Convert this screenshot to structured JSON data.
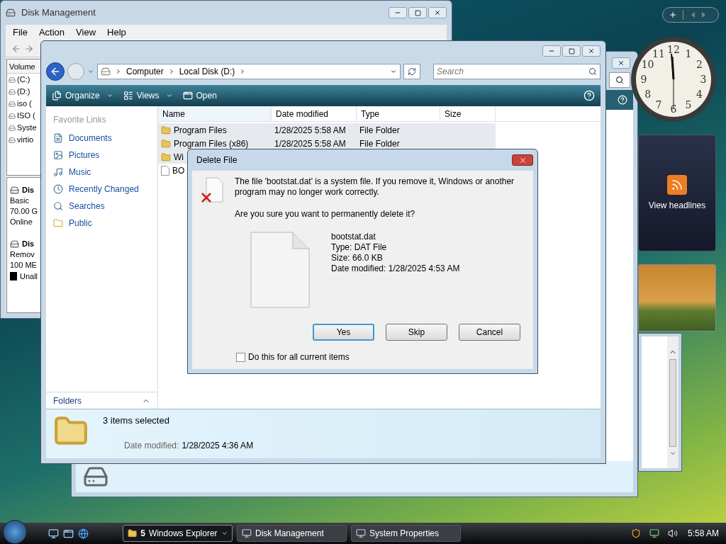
{
  "disk_management": {
    "title": "Disk Management",
    "menu": [
      "File",
      "Action",
      "View",
      "Help"
    ],
    "volume_header": "Volume",
    "volumes": [
      "(C:)",
      "(D:)",
      "iso (",
      "ISO (",
      "Syste",
      "virtio"
    ],
    "disks": [
      {
        "name": "Dis",
        "lines": [
          "Basic",
          "70.00 G",
          "Online"
        ]
      },
      {
        "name": "Dis",
        "lines": [
          "Remov",
          "100 ME"
        ]
      }
    ],
    "legend": "Unall"
  },
  "explorer": {
    "breadcrumbs": [
      "Computer",
      "Local Disk (D:)"
    ],
    "search": {
      "placeholder": "Search"
    },
    "toolbar": [
      {
        "label": "Organize",
        "has_menu": true
      },
      {
        "label": "Views",
        "has_menu": true
      },
      {
        "label": "Open",
        "has_menu": false
      }
    ],
    "favorite_links": {
      "title": "Favorite Links",
      "items": [
        "Documents",
        "Pictures",
        "Music",
        "Recently Changed",
        "Searches",
        "Public"
      ]
    },
    "folders_label": "Folders",
    "columns": [
      "Name",
      "Date modified",
      "Type",
      "Size"
    ],
    "rows": [
      {
        "name": "Program Files",
        "date": "1/28/2025 5:58 AM",
        "type": "File Folder",
        "selected": true
      },
      {
        "name": "Program Files (x86)",
        "date": "1/28/2025 5:58 AM",
        "type": "File Folder",
        "selected": true
      },
      {
        "name": "Wi",
        "selected": true
      },
      {
        "name": "BO",
        "selected": false
      }
    ],
    "details": {
      "summary": "3 items selected",
      "label": "Date modified:",
      "value": "1/28/2025 4:36 AM"
    }
  },
  "dialog": {
    "title": "Delete File",
    "message": "The file 'bootstat.dat' is a system file. If you remove it, Windows or another program may no longer work correctly.",
    "question": "Are you sure you want to permanently delete it?",
    "file_info": [
      "bootstat.dat",
      "Type: DAT File",
      "Size: 66.0 KB",
      "Date modified: 1/28/2025 4:53 AM"
    ],
    "buttons": [
      {
        "label": "Yes",
        "default": true
      },
      {
        "label": "Skip",
        "default": false
      },
      {
        "label": "Cancel",
        "default": false
      }
    ],
    "checkbox": {
      "label": "Do this for all current items",
      "checked": false
    }
  },
  "gadgets": {
    "clock_numerals": [
      "12",
      "11",
      "1",
      "10",
      "2",
      "9",
      "3",
      "8",
      "4",
      "7",
      "5",
      "6"
    ],
    "feed": "View headlines"
  },
  "taskbar": {
    "buttons": [
      {
        "count": "5",
        "label": "Windows Explorer",
        "selected": true,
        "has_menu": true
      },
      {
        "label": "Disk Management",
        "selected": false,
        "has_menu": false
      },
      {
        "label": "System Properties",
        "selected": false,
        "has_menu": false
      }
    ],
    "time": "5:58 AM"
  }
}
